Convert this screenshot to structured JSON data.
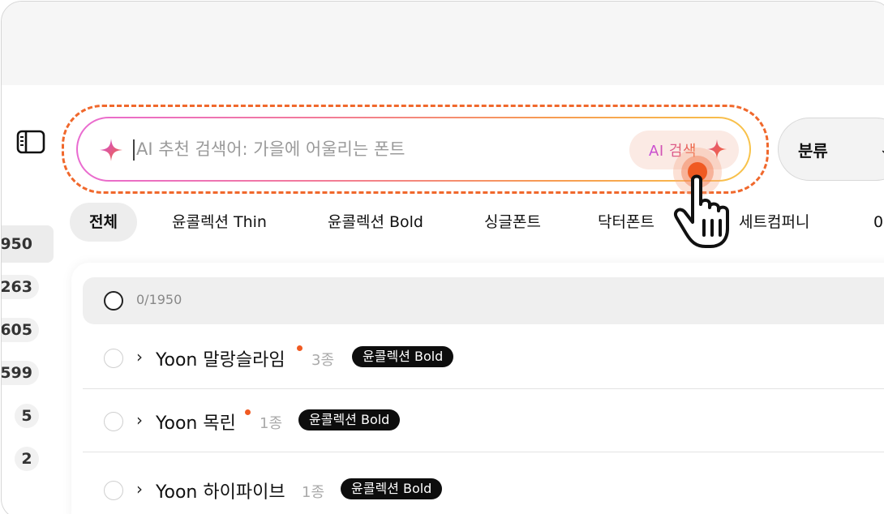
{
  "search": {
    "placeholder": "AI 추천 검색어: 가을에 어울리는 폰트",
    "ai_button_label": "AI 검색"
  },
  "filter": {
    "label": "분류"
  },
  "tabs": [
    {
      "label": "전체",
      "active": true
    },
    {
      "label": "윤콜렉션 Thin"
    },
    {
      "label": "윤콜렉션 Bold"
    },
    {
      "label": "싱글폰트"
    },
    {
      "label": "닥터폰트"
    },
    {
      "label": "세트컴퍼니"
    },
    {
      "label": "0"
    }
  ],
  "sidebar_counts": [
    "950",
    "263",
    "605",
    "599",
    "5",
    "2"
  ],
  "list": {
    "selection_count": "0/1950",
    "rows": [
      {
        "name": "Yoon 말랑슬라임",
        "is_new": true,
        "count": "3종",
        "badge": "윤콜렉션 Bold"
      },
      {
        "name": "Yoon 목린",
        "is_new": true,
        "count": "1종",
        "badge": "윤콜렉션 Bold"
      },
      {
        "name": "Yoon 하이파이브",
        "is_new": false,
        "count": "1종",
        "badge": "윤콜렉션 Bold"
      }
    ]
  },
  "colors": {
    "accent": "#f05a22",
    "gradient_start": "#e96bd1",
    "gradient_end": "#f8c34a",
    "badge_bg": "#0d0d0d"
  },
  "icons": {
    "sidebar_toggle": "sidebar-panel-icon",
    "sparkle": "sparkle-icon",
    "pointer": "hand-pointer-icon"
  }
}
